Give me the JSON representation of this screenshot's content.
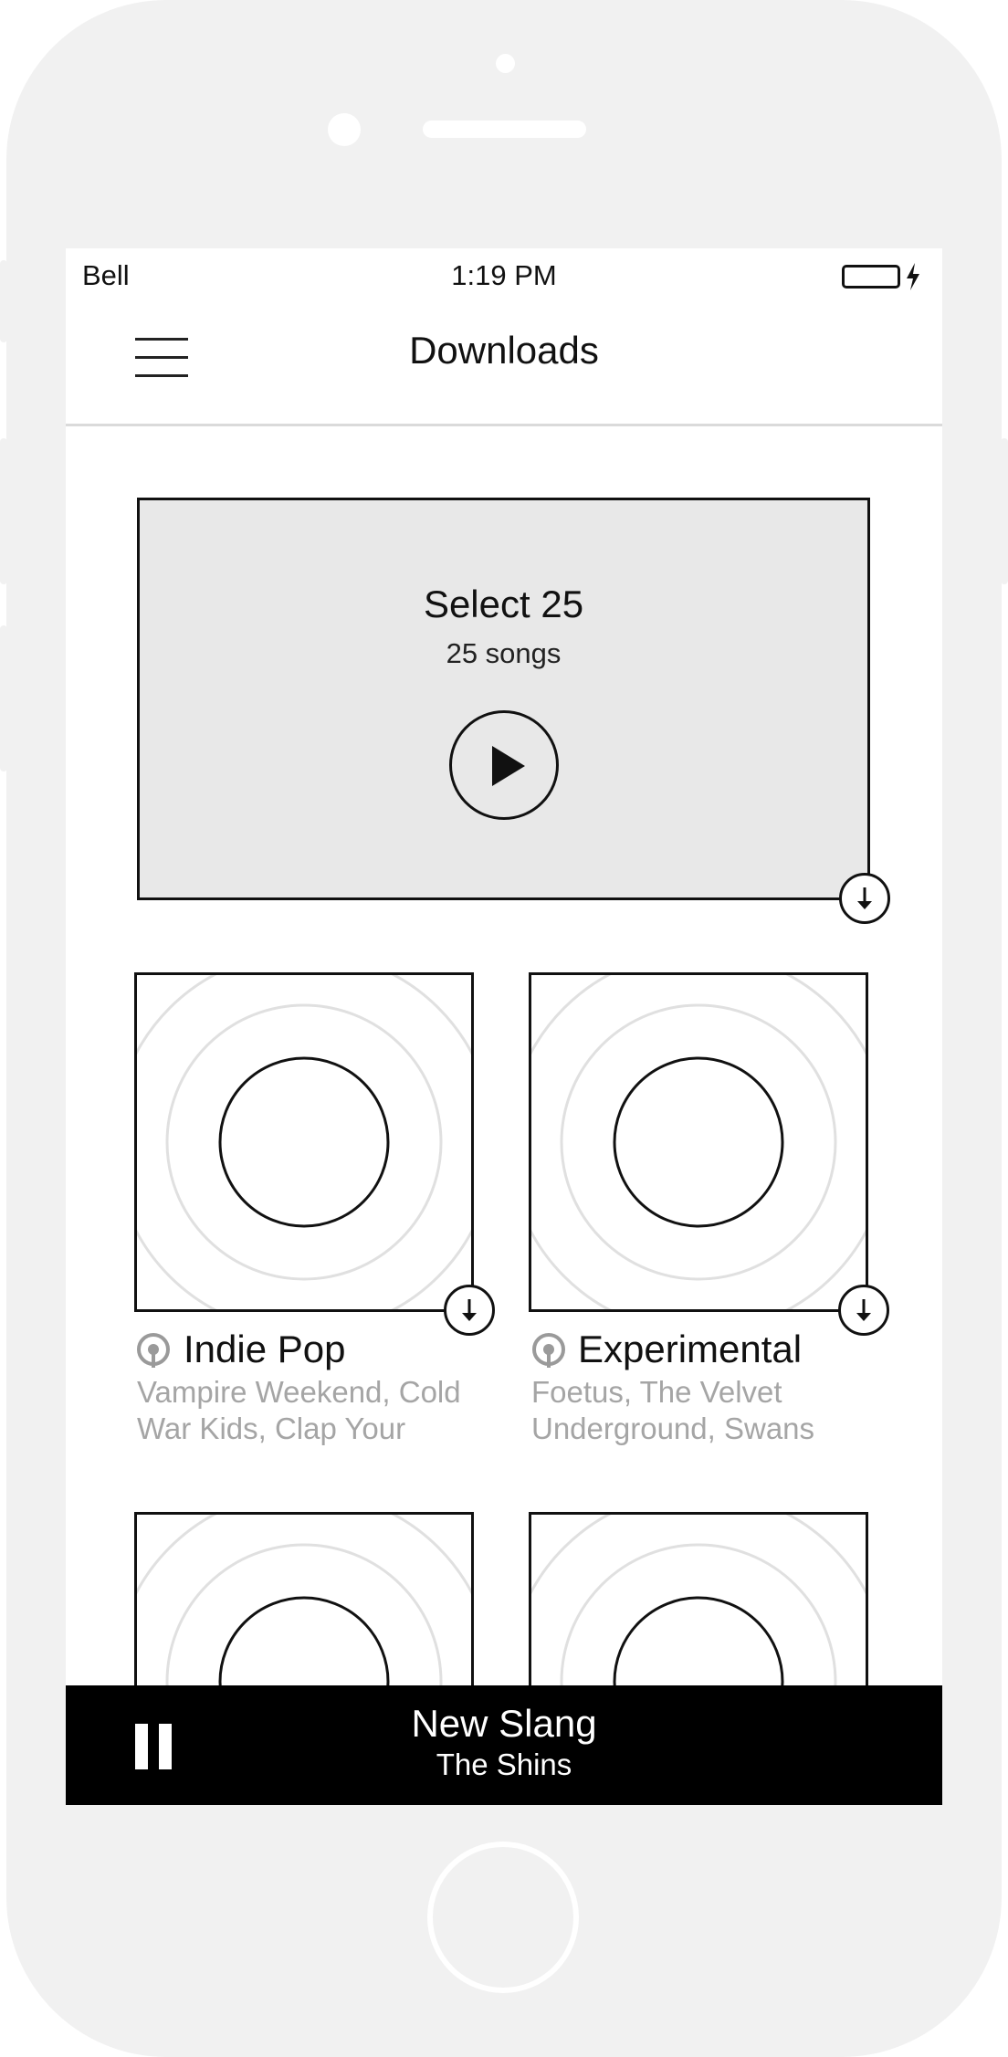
{
  "status_bar": {
    "carrier": "Bell",
    "time": "1:19 PM"
  },
  "nav": {
    "title": "Downloads"
  },
  "featured": {
    "title": "Select 25",
    "subtitle": "25 songs"
  },
  "stations": [
    {
      "name": "Indie Pop",
      "description": "Vampire Weekend, Cold War Kids, Clap Your"
    },
    {
      "name": "Experimental",
      "description": "Foetus, The Velvet Underground, Swans"
    },
    {
      "name": "",
      "description": ""
    },
    {
      "name": "",
      "description": ""
    }
  ],
  "now_playing": {
    "title": "New Slang",
    "artist": "The Shins"
  },
  "colors": {
    "frame": "#f1f1f1",
    "featured_bg": "#e8e8e8",
    "player_bg": "#000000",
    "muted_text": "#a5a5a5"
  },
  "icons": [
    "menu-icon",
    "play-icon",
    "download-icon",
    "podcast-icon",
    "pause-icon",
    "battery-icon",
    "charging-bolt-icon"
  ]
}
